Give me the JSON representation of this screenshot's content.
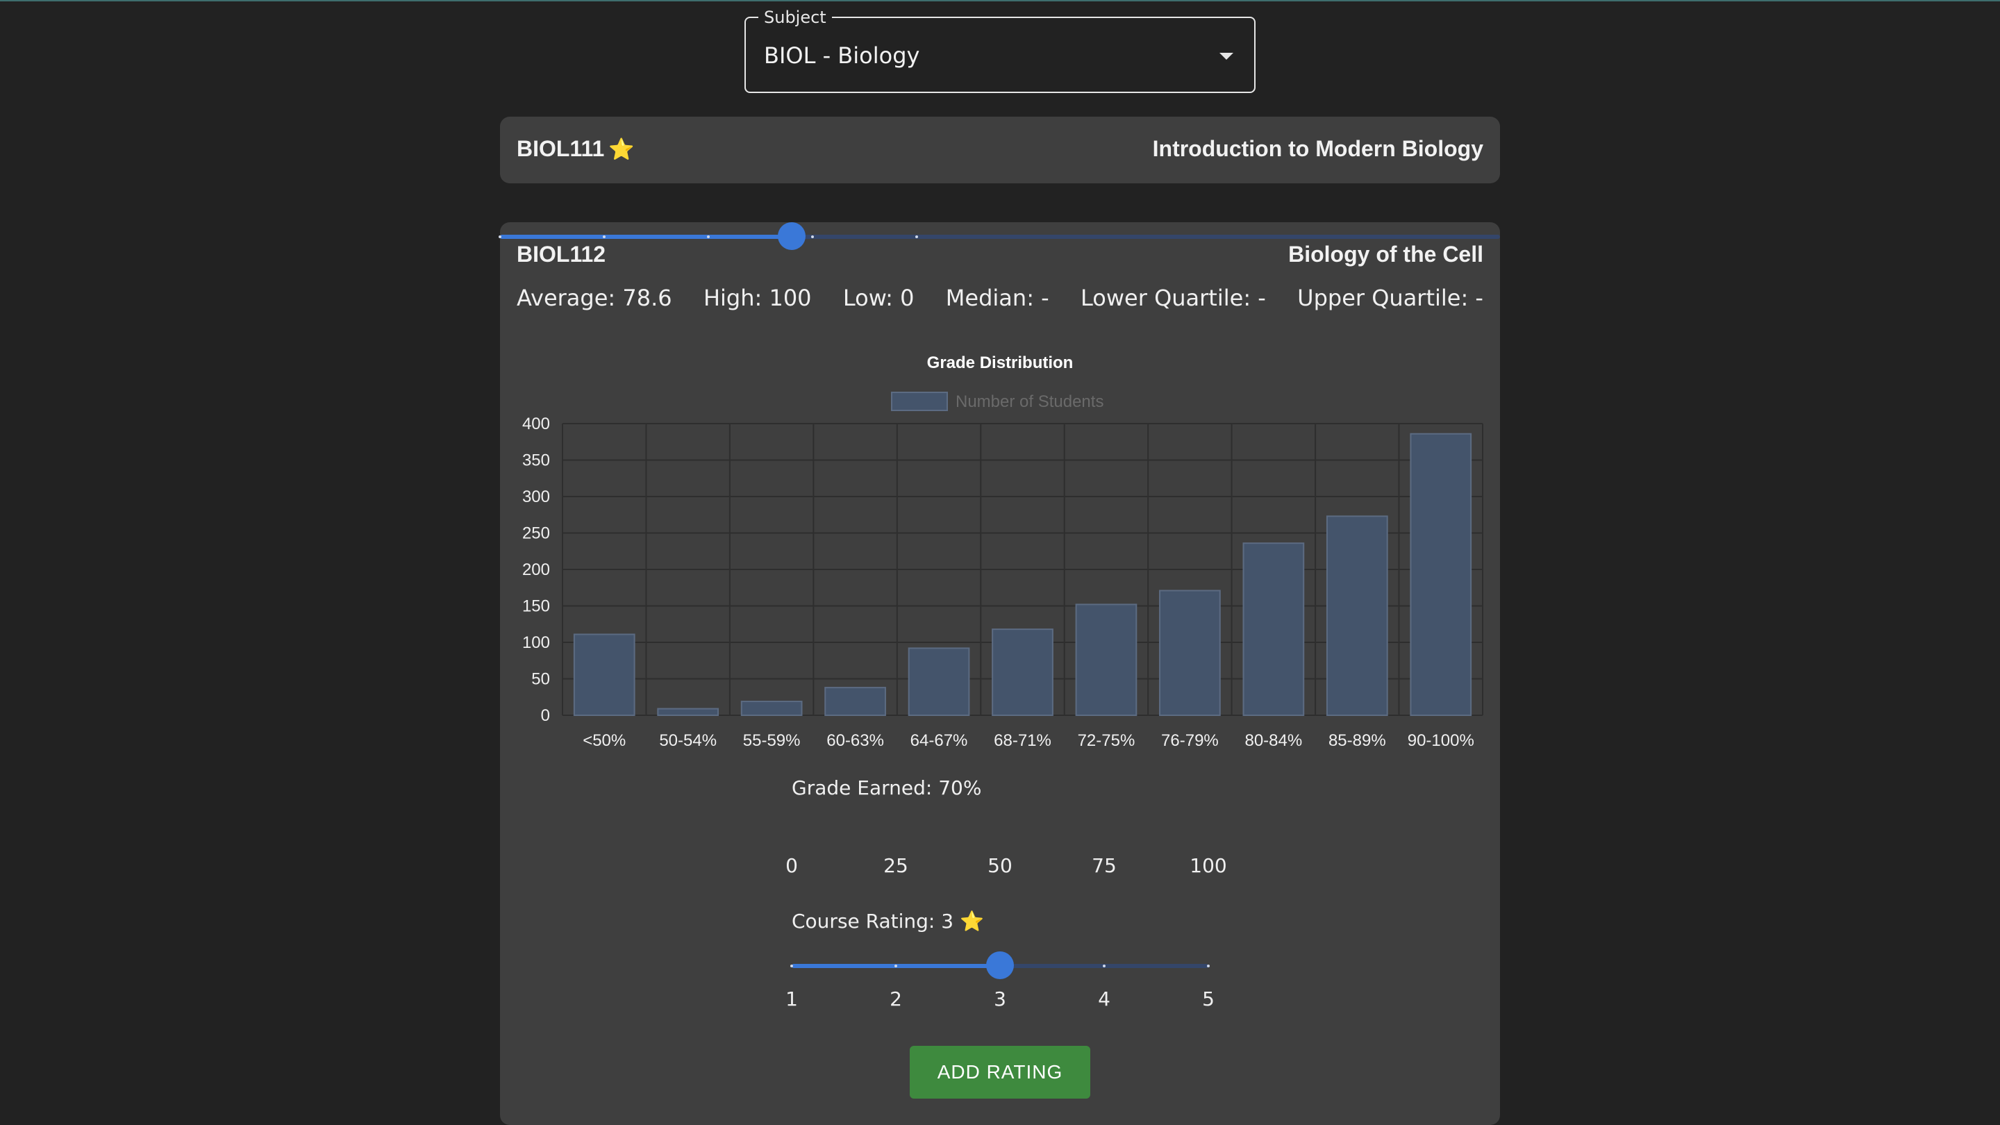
{
  "subject_select": {
    "label": "Subject",
    "value": "BIOL - Biology"
  },
  "courses": [
    {
      "code": "BIOL111",
      "starred": true,
      "star_icon": "⭐",
      "title": "Introduction to Modern Biology"
    },
    {
      "code": "BIOL112",
      "title": "Biology of the Cell",
      "stats": {
        "average": "Average: 78.6",
        "high": "High: 100",
        "low": "Low: 0",
        "median": "Median: -",
        "lower_quartile": "Lower Quartile: -",
        "upper_quartile": "Upper Quartile: -"
      },
      "grade_slider": {
        "label": "Grade Earned: 70%",
        "value": 70,
        "min": 0,
        "max": 100,
        "ticks": [
          "0",
          "25",
          "50",
          "75",
          "100"
        ]
      },
      "rating_slider": {
        "label": "Course Rating: 3",
        "star_icon": "⭐",
        "value": 3,
        "min": 1,
        "max": 5,
        "ticks": [
          "1",
          "2",
          "3",
          "4",
          "5"
        ]
      },
      "add_button_label": "ADD RATING"
    }
  ],
  "colors": {
    "background": "#222222",
    "card": "#3f3f3f",
    "bar_fill": "#44546b",
    "bar_stroke": "#5c6b82",
    "slider_accent": "#3a78d8",
    "button": "#3e8a3e"
  },
  "chart_data": {
    "type": "bar",
    "title": "Grade Distribution",
    "legend": "Number of Students",
    "legend_position": "top-center",
    "categories": [
      "<50%",
      "50-54%",
      "55-59%",
      "60-63%",
      "64-67%",
      "68-71%",
      "72-75%",
      "76-79%",
      "80-84%",
      "85-89%",
      "90-100%"
    ],
    "series": [
      {
        "name": "Number of Students",
        "values": [
          111,
          9,
          19,
          38,
          92,
          118,
          152,
          171,
          236,
          273,
          386
        ]
      }
    ],
    "yticks": [
      "0",
      "50",
      "100",
      "150",
      "200",
      "250",
      "300",
      "350",
      "400"
    ],
    "ylim": [
      0,
      400
    ],
    "grid": true
  }
}
